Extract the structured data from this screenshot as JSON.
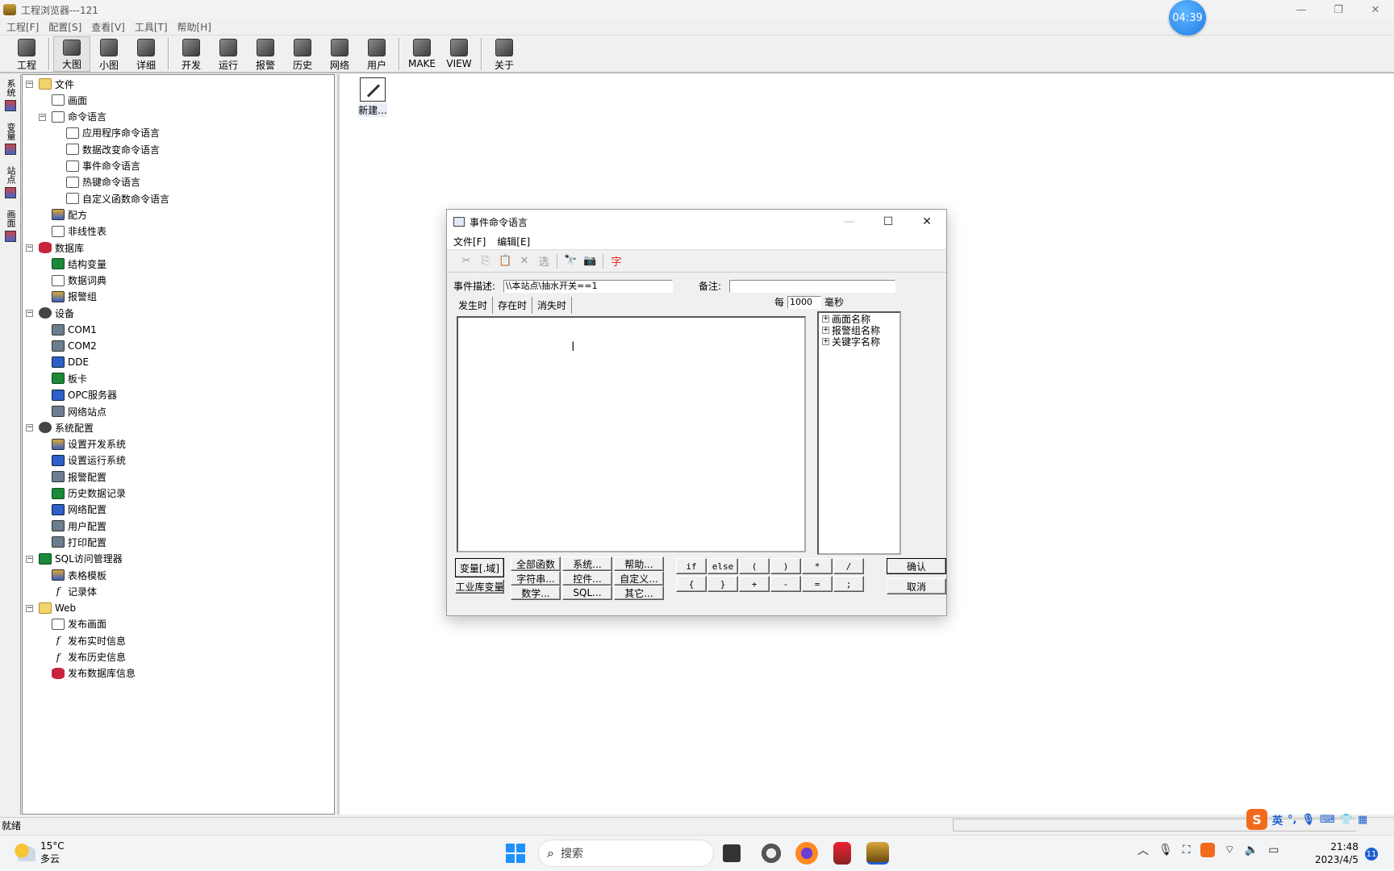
{
  "window": {
    "title": "工程浏览器---121",
    "badge_time": "04:39",
    "controls": [
      "—",
      "❐",
      "✕"
    ]
  },
  "menubar": [
    "工程[F]",
    "配置[S]",
    "查看[V]",
    "工具[T]",
    "帮助[H]"
  ],
  "toolbar": [
    {
      "label": "工程",
      "icon": "project-icon"
    },
    {
      "label": "大图",
      "icon": "large-icon-view-icon"
    },
    {
      "label": "小图",
      "icon": "small-icon-view-icon"
    },
    {
      "label": "详细",
      "icon": "detail-view-icon"
    },
    {
      "label": "开发",
      "icon": "develop-icon"
    },
    {
      "label": "运行",
      "icon": "run-icon"
    },
    {
      "label": "报警",
      "icon": "alarm-icon"
    },
    {
      "label": "历史",
      "icon": "history-icon"
    },
    {
      "label": "网络",
      "icon": "network-icon"
    },
    {
      "label": "用户",
      "icon": "user-icon"
    },
    {
      "label": "MAKE",
      "icon": "make-icon"
    },
    {
      "label": "VIEW",
      "icon": "view-icon"
    },
    {
      "label": "关于",
      "icon": "about-icon"
    }
  ],
  "vtabs": [
    "系统",
    "变量",
    "站点",
    "画面"
  ],
  "tree": [
    {
      "label": "文件",
      "level": 0,
      "exp": "−",
      "icon": "folder"
    },
    {
      "label": "画面",
      "level": 1,
      "icon": "doc"
    },
    {
      "label": "命令语言",
      "level": 1,
      "exp": "−",
      "icon": "doc"
    },
    {
      "label": "应用程序命令语言",
      "level": 2,
      "icon": "doc"
    },
    {
      "label": "数据改变命令语言",
      "level": 2,
      "icon": "doc"
    },
    {
      "label": "事件命令语言",
      "level": 2,
      "icon": "doc"
    },
    {
      "label": "热键命令语言",
      "level": 2,
      "icon": "doc"
    },
    {
      "label": "自定义函数命令语言",
      "level": 2,
      "icon": "doc"
    },
    {
      "label": "配方",
      "level": 1,
      "icon": "mixed"
    },
    {
      "label": "非线性表",
      "level": 1,
      "icon": "doc"
    },
    {
      "label": "数据库",
      "level": 0,
      "exp": "−",
      "icon": "db"
    },
    {
      "label": "结构变量",
      "level": 1,
      "icon": "green"
    },
    {
      "label": "数据词典",
      "level": 1,
      "icon": "doc"
    },
    {
      "label": "报警组",
      "level": 1,
      "icon": "mixed"
    },
    {
      "label": "设备",
      "level": 0,
      "exp": "−",
      "icon": "gear"
    },
    {
      "label": "COM1",
      "level": 1,
      "icon": "dev"
    },
    {
      "label": "COM2",
      "level": 1,
      "icon": "dev"
    },
    {
      "label": "DDE",
      "level": 1,
      "icon": "blue"
    },
    {
      "label": "板卡",
      "level": 1,
      "icon": "green"
    },
    {
      "label": "OPC服务器",
      "level": 1,
      "icon": "blue"
    },
    {
      "label": "网络站点",
      "level": 1,
      "icon": "dev"
    },
    {
      "label": "系统配置",
      "level": 0,
      "exp": "−",
      "icon": "gear"
    },
    {
      "label": "设置开发系统",
      "level": 1,
      "icon": "mixed"
    },
    {
      "label": "设置运行系统",
      "level": 1,
      "icon": "blue"
    },
    {
      "label": "报警配置",
      "level": 1,
      "icon": "dev"
    },
    {
      "label": "历史数据记录",
      "level": 1,
      "icon": "green"
    },
    {
      "label": "网络配置",
      "level": 1,
      "icon": "blue"
    },
    {
      "label": "用户配置",
      "level": 1,
      "icon": "dev"
    },
    {
      "label": "打印配置",
      "level": 1,
      "icon": "dev"
    },
    {
      "label": "SQL访问管理器",
      "level": 0,
      "exp": "−",
      "icon": "green"
    },
    {
      "label": "表格模板",
      "level": 1,
      "icon": "mixed"
    },
    {
      "label": "记录体",
      "level": 1,
      "icon": "fx"
    },
    {
      "label": "Web",
      "level": 0,
      "exp": "−",
      "icon": "folder"
    },
    {
      "label": "发布画面",
      "level": 1,
      "icon": "doc"
    },
    {
      "label": "发布实时信息",
      "level": 1,
      "icon": "fx"
    },
    {
      "label": "发布历史信息",
      "level": 1,
      "icon": "fx"
    },
    {
      "label": "发布数据库信息",
      "level": 1,
      "icon": "db"
    }
  ],
  "workspace": {
    "new_label": "新建..."
  },
  "status": {
    "text": "就绪"
  },
  "ime": {
    "lang": "英"
  },
  "dialog": {
    "title": "事件命令语言",
    "menu": [
      "文件[F]",
      "编辑[E]"
    ],
    "tools": [
      "✂",
      "⎘",
      "📋",
      "✕",
      "选",
      "|",
      "🔭",
      "📷",
      "|",
      "字"
    ],
    "desc_label": "事件描述:",
    "desc_value": "\\\\本站点\\抽水开关==1",
    "note_label": "备注:",
    "note_value": "",
    "tabs": [
      "发生时",
      "存在时",
      "消失时"
    ],
    "active_tab": 1,
    "per_label": "每",
    "per_value": "1000",
    "per_unit": "毫秒",
    "side_tree": [
      "画面名称",
      "报警组名称",
      "关键字名称"
    ],
    "btn_var": "变量[.域]",
    "btn_lib": "工业库变量",
    "fn_buttons": [
      "全部函数",
      "系统...",
      "帮助...",
      "字符串...",
      "控件...",
      "自定义...",
      "数学...",
      "SQL...",
      "其它..."
    ],
    "op_buttons": [
      "if",
      "else",
      "(",
      ")",
      "*",
      "/",
      "{",
      "}",
      "+",
      "-",
      "=",
      ";"
    ],
    "ok": "确认",
    "cancel": "取消"
  },
  "taskbar": {
    "weather_temp": "15°C",
    "weather_desc": "多云",
    "search_placeholder": "搜索",
    "time": "21:48",
    "date": "2023/4/5",
    "notif_count": "11"
  }
}
